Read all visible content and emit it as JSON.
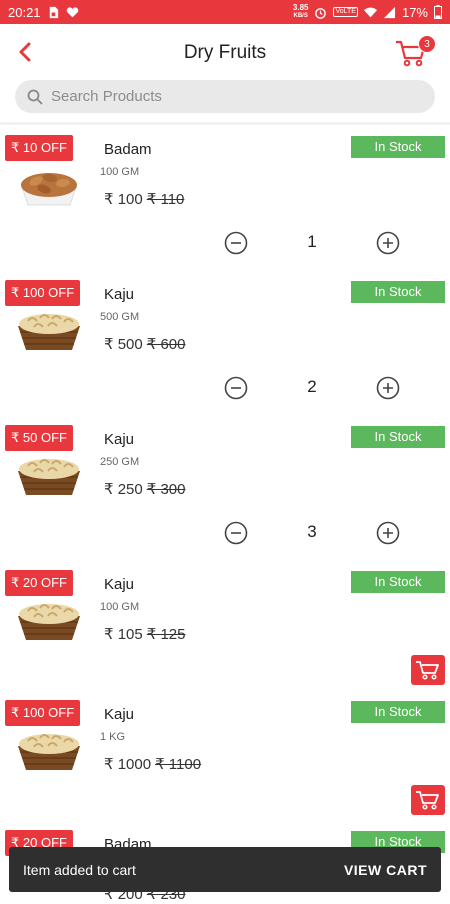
{
  "status_bar": {
    "time": "20:21",
    "speed_top": "3.85",
    "speed_unit": "KB/S",
    "volte": "VoLTE",
    "battery": "17%"
  },
  "header": {
    "title": "Dry Fruits",
    "cart_count": "3"
  },
  "search": {
    "placeholder": "Search Products"
  },
  "currency": "₹",
  "products": [
    {
      "offer": "₹ 10 OFF",
      "name": "Badam",
      "weight": "100 GM",
      "price": "₹ 100",
      "mrp": "₹ 110",
      "stock": "In Stock",
      "qty": "1"
    },
    {
      "offer": "₹ 100 OFF",
      "name": "Kaju",
      "weight": "500 GM",
      "price": "₹ 500",
      "mrp": "₹ 600",
      "stock": "In Stock",
      "qty": "2"
    },
    {
      "offer": "₹ 50 OFF",
      "name": "Kaju",
      "weight": "250 GM",
      "price": "₹ 250",
      "mrp": "₹ 300",
      "stock": "In Stock",
      "qty": "3"
    },
    {
      "offer": "₹ 20 OFF",
      "name": "Kaju",
      "weight": "100 GM",
      "price": "₹ 105",
      "mrp": "₹ 125",
      "stock": "In Stock"
    },
    {
      "offer": "₹ 100 OFF",
      "name": "Kaju",
      "weight": "1 KG",
      "price": "₹ 1000",
      "mrp": "₹ 1100",
      "stock": "In Stock"
    },
    {
      "offer": "₹ 20 OFF",
      "name": "Badam",
      "weight": "",
      "price": "₹ 200",
      "mrp": "₹ 230",
      "stock": "In Stock"
    }
  ],
  "snackbar": {
    "message": "Item added to cart",
    "action": "VIEW CART"
  },
  "colors": {
    "accent": "#e9383d",
    "stock": "#5cb85c",
    "snackbar": "#2f2f2f"
  }
}
